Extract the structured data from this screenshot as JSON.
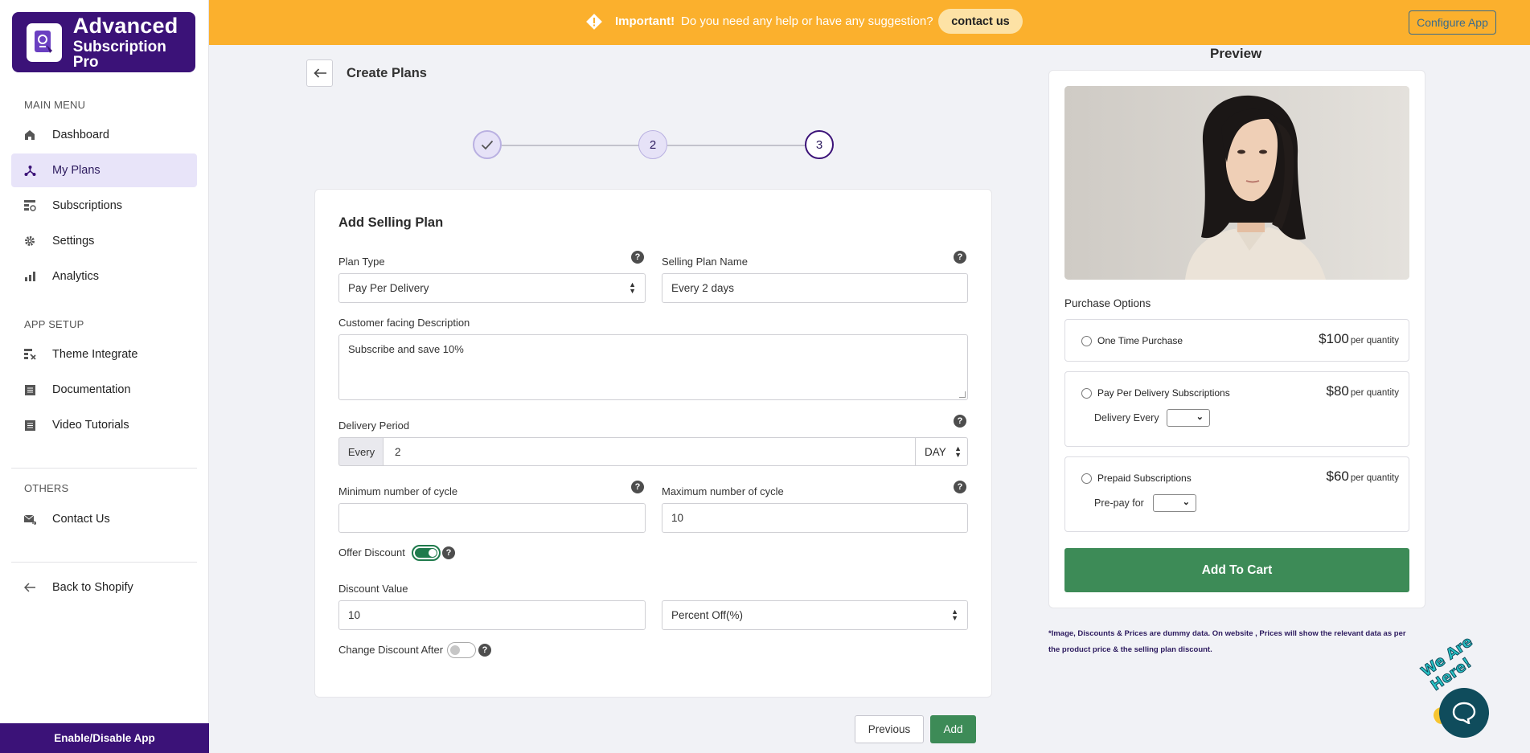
{
  "sidebar": {
    "logo_line1": "Advanced",
    "logo_line2": "Subscription Pro",
    "main_menu_heading": "MAIN MENU",
    "main_menu": [
      {
        "label": "Dashboard",
        "icon": "home-icon"
      },
      {
        "label": "My Plans",
        "icon": "plans-icon",
        "active": true
      },
      {
        "label": "Subscriptions",
        "icon": "subscriptions-icon"
      },
      {
        "label": "Settings",
        "icon": "gear-icon"
      },
      {
        "label": "Analytics",
        "icon": "bar-chart-icon"
      }
    ],
    "app_setup_heading": "APP SETUP",
    "app_setup": [
      {
        "label": "Theme Integrate",
        "icon": "theme-icon"
      },
      {
        "label": "Documentation",
        "icon": "document-icon"
      },
      {
        "label": "Video Tutorials",
        "icon": "video-icon"
      }
    ],
    "others_heading": "OTHERS",
    "others": [
      {
        "label": "Contact Us",
        "icon": "mail-icon"
      }
    ],
    "back_label": "Back to Shopify",
    "enable_label": "Enable/Disable App"
  },
  "banner": {
    "important": "Important!",
    "message": "Do you need any help or have any suggestion?",
    "contact_label": "contact us",
    "configure_label": "Configure App",
    "color": "#fbb02d"
  },
  "page": {
    "title": "Create Plans",
    "steps": [
      "✓",
      "2",
      "3"
    ]
  },
  "form": {
    "card_title": "Add Selling Plan",
    "plan_type_label": "Plan Type",
    "plan_type_value": "Pay Per Delivery",
    "plan_name_label": "Selling Plan Name",
    "plan_name_value": "Every 2 days",
    "desc_label": "Customer facing Description",
    "desc_value": "Subscribe and save 10%",
    "delivery_label": "Delivery Period",
    "every_label": "Every",
    "every_value": "2",
    "every_unit": "DAY",
    "min_cycle_label": "Minimum number of cycle",
    "min_cycle_value": "",
    "max_cycle_label": "Maximum number of cycle",
    "max_cycle_value": "10",
    "offer_discount_label": "Offer Discount",
    "offer_discount_on": true,
    "discount_value_label": "Discount Value",
    "discount_value": "10",
    "discount_type": "Percent Off(%)",
    "change_discount_label": "Change Discount After",
    "change_discount_on": false,
    "previous_label": "Previous",
    "add_label": "Add"
  },
  "preview": {
    "title": "Preview",
    "purchase_options_title": "Purchase Options",
    "options": [
      {
        "name": "One Time Purchase",
        "price": "$100",
        "unit": "per quantity"
      },
      {
        "name": "Pay Per Delivery Subscriptions",
        "price": "$80",
        "unit": "per quantity",
        "sub_label": "Delivery Every"
      },
      {
        "name": "Prepaid Subscriptions",
        "price": "$60",
        "unit": "per quantity",
        "sub_label": "Pre-pay for"
      }
    ],
    "add_to_cart": "Add To Cart",
    "note": "*Image, Discounts & Prices are dummy data. On website , Prices will show the relevant data as per the product price & the selling plan discount.",
    "button_color": "#3d8b57"
  },
  "chat": {
    "badge_text": "We Are Here!"
  }
}
